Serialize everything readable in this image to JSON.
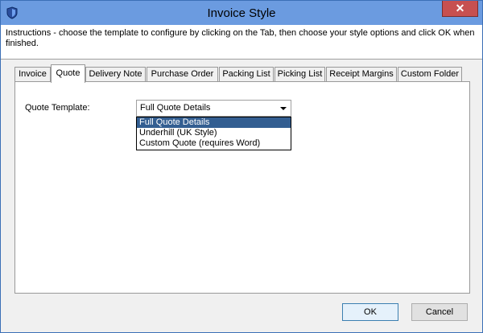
{
  "window": {
    "title": "Invoice Style",
    "close_glyph": "✕"
  },
  "instructions": "Instructions - choose the template to configure by clicking on the Tab, then choose your style options and click OK when finished.",
  "tabs": [
    {
      "label": "Invoice",
      "active": false
    },
    {
      "label": "Quote",
      "active": true
    },
    {
      "label": "Delivery Note",
      "active": false
    },
    {
      "label": "Purchase Order",
      "active": false
    },
    {
      "label": "Packing List",
      "active": false
    },
    {
      "label": "Picking List",
      "active": false
    },
    {
      "label": "Receipt Margins",
      "active": false
    },
    {
      "label": "Custom Folder",
      "active": false
    }
  ],
  "quote": {
    "template_label": "Quote Template:",
    "selected": "Full Quote Details",
    "options": [
      {
        "label": "Full Quote Details",
        "highlighted": true
      },
      {
        "label": "Underhill (UK Style)",
        "highlighted": false
      },
      {
        "label": "Custom Quote (requires Word)",
        "highlighted": false
      }
    ]
  },
  "buttons": {
    "ok": "OK",
    "cancel": "Cancel"
  },
  "colors": {
    "titlebar": "#6b9be0",
    "close": "#c75050",
    "highlight": "#335e91"
  }
}
